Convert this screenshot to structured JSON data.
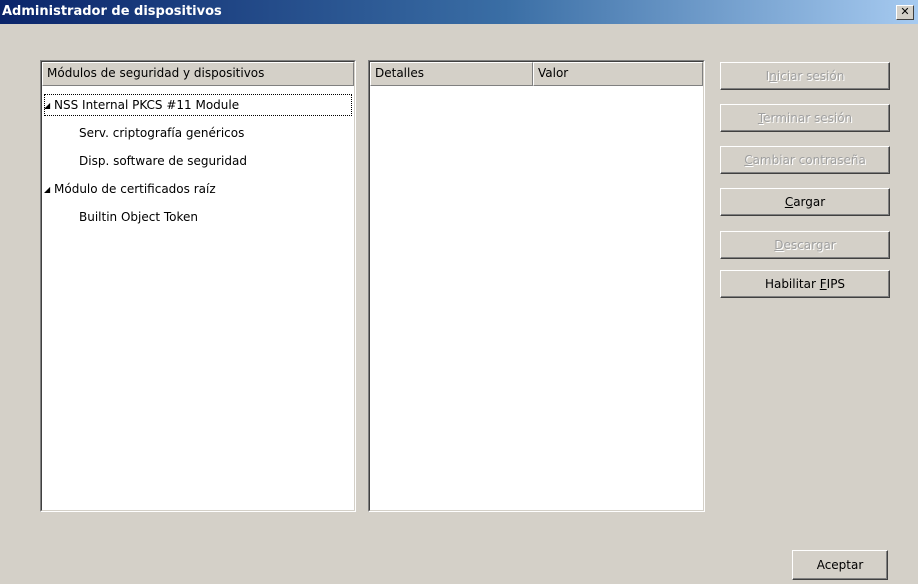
{
  "window": {
    "title": "Administrador de dispositivos",
    "close_glyph": "✕"
  },
  "tree": {
    "header": "Módulos de seguridad y dispositivos",
    "items": [
      {
        "label": "NSS Internal PKCS #11 Module",
        "twisty": "◢",
        "level": 0,
        "selected": true
      },
      {
        "label": "Serv. criptografía genéricos",
        "level": 1
      },
      {
        "label": "Disp. software de seguridad",
        "level": 1
      },
      {
        "label": "Módulo de certificados raíz",
        "twisty": "◢",
        "level": 0
      },
      {
        "label": "Builtin Object Token",
        "level": 1
      }
    ]
  },
  "details": {
    "headers": [
      "Detalles",
      "Valor"
    ]
  },
  "buttons": [
    {
      "pre": "I",
      "key": "n",
      "post": "iciar sesión",
      "enabled": false
    },
    {
      "pre": "",
      "key": "T",
      "post": "erminar sesión",
      "enabled": false
    },
    {
      "pre": "",
      "key": "C",
      "post": "ambiar contraseña",
      "enabled": false
    },
    {
      "pre": "",
      "key": "C",
      "post": "argar",
      "enabled": true
    },
    {
      "pre": "",
      "key": "D",
      "post": "escargar",
      "enabled": false
    },
    {
      "pre": "Habilitar ",
      "key": "F",
      "post": "IPS",
      "enabled": true
    }
  ],
  "accept": {
    "label": "Aceptar"
  }
}
